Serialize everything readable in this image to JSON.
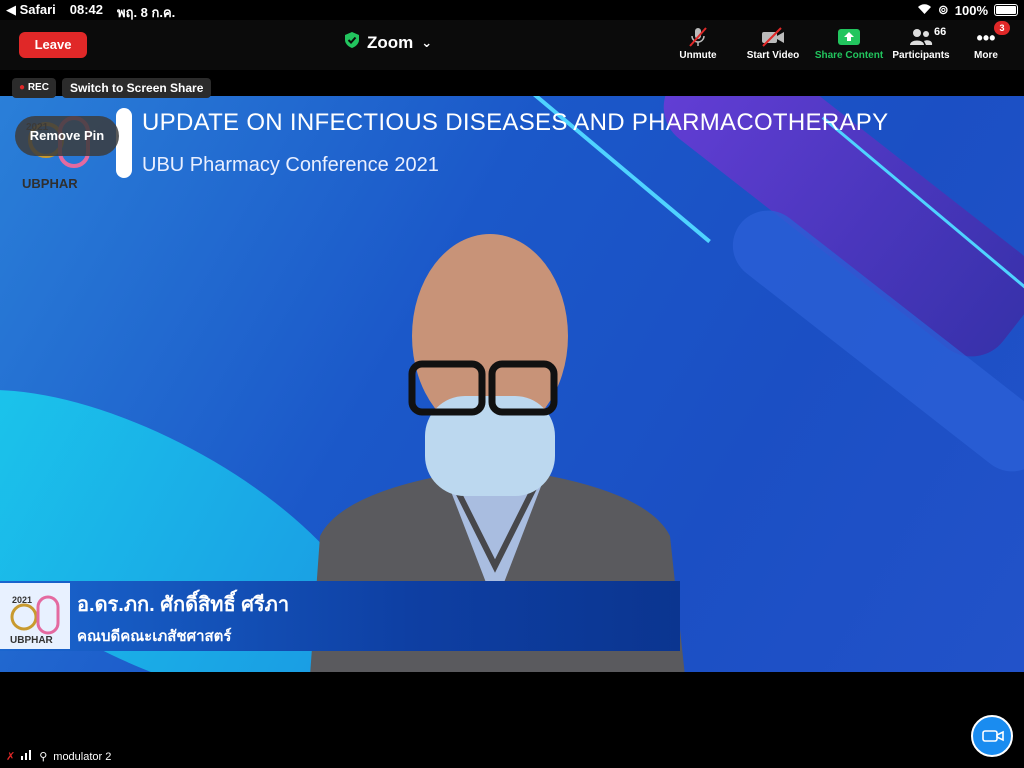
{
  "statusbar": {
    "back_app": "◀ Safari",
    "time": "08:42",
    "date": "พฤ. 8 ก.ค.",
    "battery": "100%"
  },
  "topbar": {
    "leave_label": "Leave",
    "app_title": "Zoom",
    "unmute_label": "Unmute",
    "start_video_label": "Start Video",
    "share_label": "Share Content",
    "participants_label": "Participants",
    "participants_count": "66",
    "more_label": "More",
    "more_badge": "3"
  },
  "overlay": {
    "rec_label": "REC",
    "switch_share_label": "Switch to Screen Share",
    "remove_pin_label": "Remove Pin"
  },
  "video": {
    "conference_title": "UPDATE ON INFECTIOUS DISEASES AND PHARMACOTHERAPY",
    "conference_subtitle": "UBU Pharmacy Conference 2021",
    "logo_year": "2021",
    "logo_text": "UBPHAR",
    "speaker_name": "อ.ดร.ภก. ศักดิ์สิทธิ์ ศรีภา",
    "speaker_role": "คณบดีคณะเภสัชศาสตร์"
  },
  "footer": {
    "network_name": "modulator 2"
  },
  "colors": {
    "leave": "#e02828",
    "share": "#22c55e",
    "accent": "#1a8cf0"
  }
}
